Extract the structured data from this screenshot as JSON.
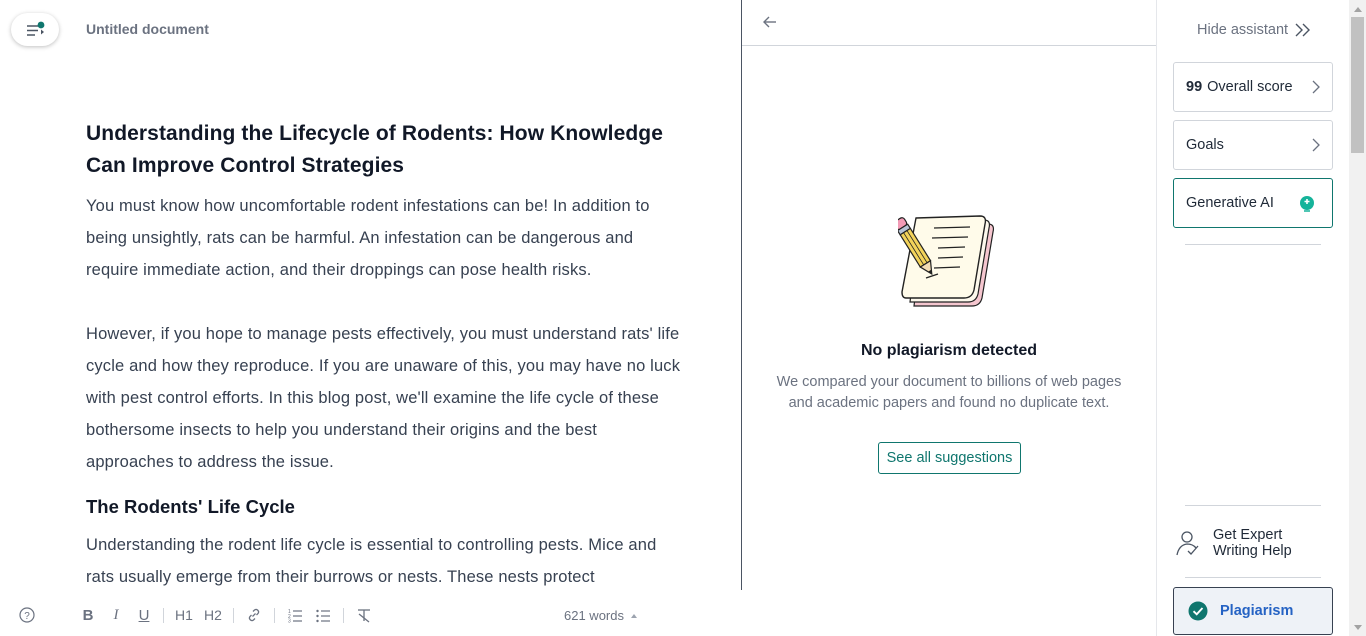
{
  "editor": {
    "doc_title": "Untitled document",
    "heading": "Understanding the Lifecycle of Rodents: How Knowledge Can Improve Control Strategies",
    "paragraph1": "You must know how uncomfortable rodent infestations can be! In addition to being unsightly, rats can be harmful. An infestation can be dangerous and require immediate action, and their droppings can pose health risks.",
    "paragraph2": "However, if you hope to manage pests effectively, you must understand rats' life cycle and how they reproduce. If you are unaware of this, you may have no luck with pest control efforts. In this blog post, we'll examine the life cycle of these bothersome insects to help you understand their origins and the best approaches to address the issue.",
    "subheading": "The Rodents' Life Cycle",
    "paragraph3": "Understanding the rodent life cycle is essential to controlling pests. Mice and rats usually emerge from their burrows or nests. These nests protect"
  },
  "toolbar": {
    "bold": "B",
    "italic": "I",
    "underline": "U",
    "h1": "H1",
    "h2": "H2",
    "word_count": "621 words"
  },
  "plagiarism_panel": {
    "title": "No plagiarism detected",
    "description": "We compared your document to billions of web pages and academic papers and found no duplicate text.",
    "button": "See all suggestions"
  },
  "sidebar": {
    "hide_label": "Hide assistant",
    "score_value": "99",
    "score_label": "Overall score",
    "goals_label": "Goals",
    "gen_ai_label": "Generative AI",
    "expert_label": "Get Expert Writing Help",
    "plagiarism_label": "Plagiarism"
  },
  "colors": {
    "accent_teal": "#0f766e",
    "plagiarism_blue": "#2563c4",
    "plagiarism_bg": "#eef2f7"
  }
}
